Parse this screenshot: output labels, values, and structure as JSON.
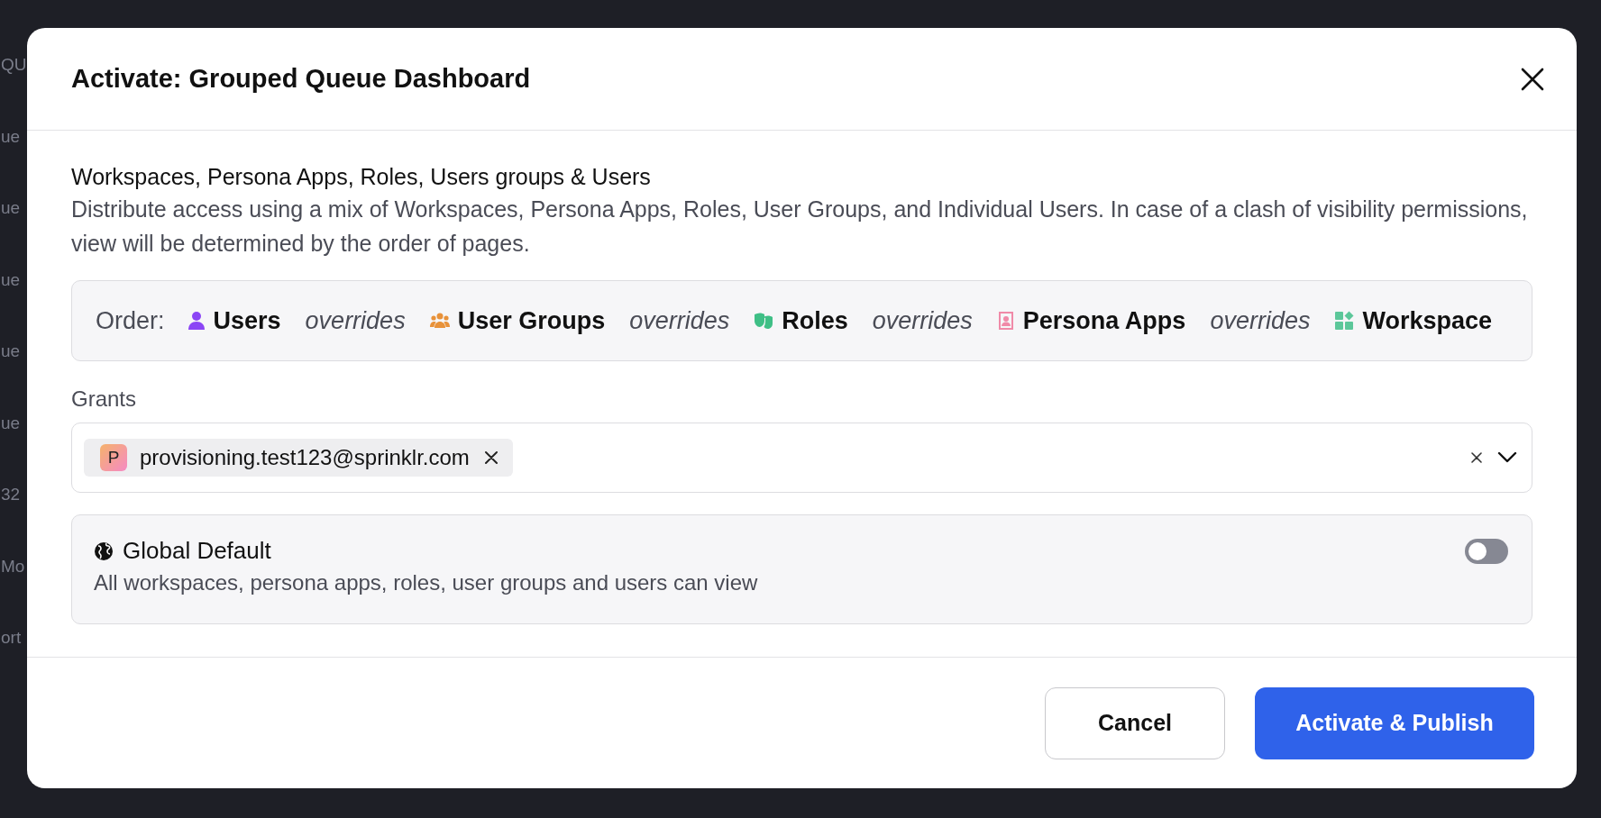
{
  "background": {
    "left_column": [
      "QU",
      "ue",
      "ue",
      "ue",
      "ue",
      "ue",
      "32",
      "Mo",
      "ort"
    ]
  },
  "dialog": {
    "title": "Activate: Grouped Queue Dashboard",
    "section": {
      "title": "Workspaces, Persona Apps, Roles, Users groups & Users",
      "description": "Distribute access using a mix of Workspaces, Persona Apps, Roles, User Groups, and Individual Users. In case of a clash of visibility permissions, view will be determined by the order of pages."
    },
    "order": {
      "label": "Order:",
      "items": [
        {
          "kind": "users",
          "color": "#8b45f5",
          "label": "Users"
        },
        {
          "kind": "separator",
          "label": "overrides"
        },
        {
          "kind": "user_groups",
          "color": "#e8923a",
          "label": "User Groups"
        },
        {
          "kind": "separator",
          "label": "overrides"
        },
        {
          "kind": "roles",
          "color": "#3fbf86",
          "label": "Roles"
        },
        {
          "kind": "separator",
          "label": "overrides"
        },
        {
          "kind": "persona_apps",
          "color": "#f08aa8",
          "label": "Persona Apps"
        },
        {
          "kind": "separator",
          "label": "overrides"
        },
        {
          "kind": "workspace",
          "color": "#5cc79a",
          "label": "Workspace"
        }
      ]
    },
    "grants": {
      "label": "Grants",
      "chips": [
        {
          "avatar": "P",
          "text": "provisioning.test123@sprinklr.com"
        }
      ]
    },
    "global_default": {
      "title": "Global Default",
      "description": "All workspaces, persona apps, roles, user groups and users can view",
      "on": false
    },
    "buttons": [
      {
        "kind": "secondary",
        "label": "Cancel"
      },
      {
        "kind": "primary",
        "label": "Activate & Publish"
      }
    ]
  }
}
